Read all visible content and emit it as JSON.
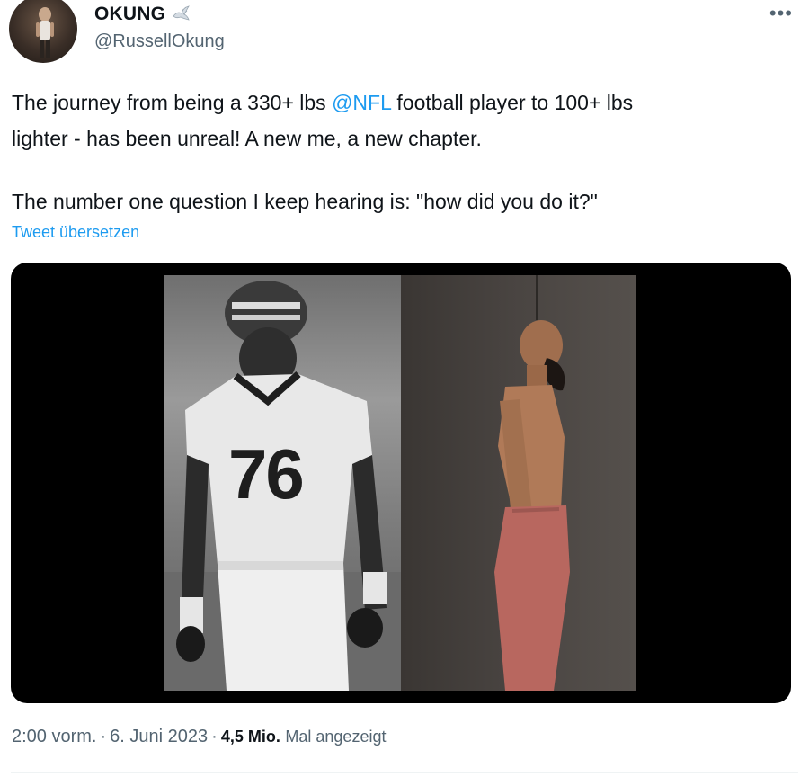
{
  "author": {
    "display_name": "OKUNG",
    "handle": "@RussellOkung",
    "badge_icon": "dove-icon"
  },
  "more_icon": "•••",
  "tweet": {
    "line1_pre": "The journey from being a 330+ lbs ",
    "mention": "@NFL",
    "line1_post": " football player to 100+ lbs",
    "line2": "lighter - has been unreal! A new me, a new chapter.",
    "line3": "The number one question I keep hearing is: \"how did you do it?\"",
    "translate_label": "Tweet übersetzen"
  },
  "media": {
    "jersey_number": "76"
  },
  "meta": {
    "time": "2:00 vorm.",
    "date": "6. Juni 2023",
    "separator": "·",
    "views_count": "4,5 Mio.",
    "views_label": "Mal angezeigt"
  },
  "colors": {
    "link": "#1d9bf0",
    "secondary_text": "#536471",
    "primary_text": "#0f1419"
  }
}
